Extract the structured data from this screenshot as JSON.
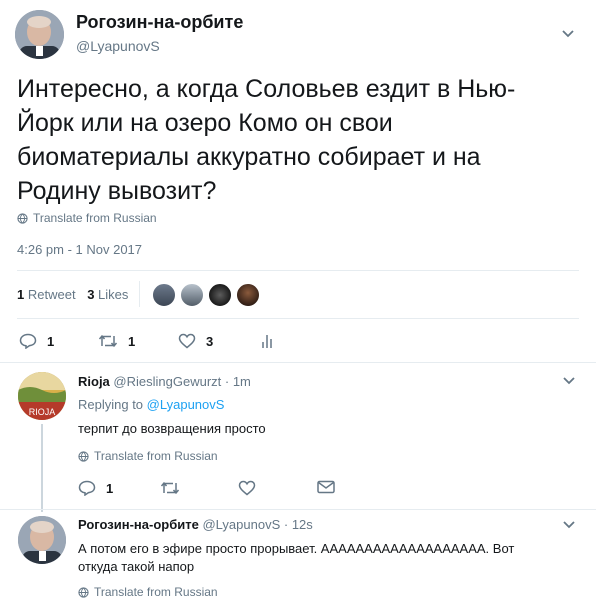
{
  "main_tweet": {
    "display_name": "Рогозин-на-орбите",
    "handle": "@LyapunovS",
    "text_lines": [
      "Интересно, а когда Соловьев ездит в Нью-",
      "Йорк или на озеро Комо он свои",
      "биоматериалы аккуратно собирает и на",
      "Родину вывозит?"
    ],
    "translate_label": "Translate from Russian",
    "timestamp": "4:26 pm - 1 Nov 2017",
    "retweets_count": "1",
    "retweets_label": "Retweet",
    "likes_count": "3",
    "likes_label": "Likes",
    "actions": {
      "reply": "1",
      "retweet": "1",
      "like": "3"
    }
  },
  "replies": [
    {
      "display_name": "Rioja",
      "handle": "@RieslingGewurzt",
      "time": "· 1m",
      "replying_prefix": "Replying to",
      "replying_to": "@LyapunovS",
      "text": "терпит до возвращения просто",
      "translate_label": "Translate from Russian",
      "actions": {
        "reply": "1"
      }
    },
    {
      "display_name": "Рогозин-на-орбите",
      "handle": "@LyapunovS",
      "time": "· 12s",
      "text_lines": [
        "А потом его в эфире просто прорывает. ААААААААААААААААААА. Вот",
        "откуда такой напор"
      ],
      "translate_label": "Translate from Russian"
    }
  ],
  "colors": {
    "accent": "#1da1f2",
    "muted": "#657786",
    "divider": "#e6ecf0"
  }
}
